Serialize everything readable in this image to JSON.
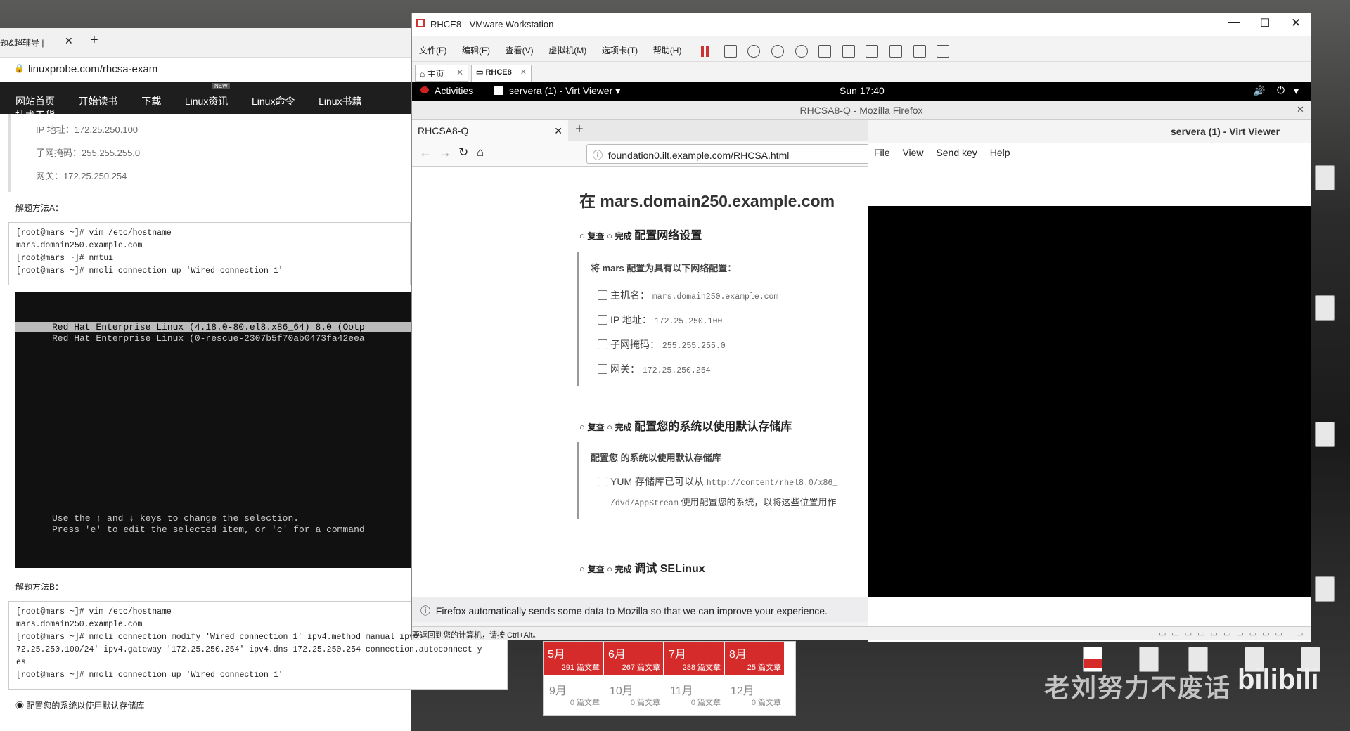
{
  "left_browser": {
    "tab_title": "题&超辅导 |",
    "url": "linuxprobe.com/rhcsa-exam",
    "nav": [
      "网站首页",
      "开始读书",
      "下载",
      "Linux资讯",
      "Linux命令",
      "Linux书籍",
      "技术干货"
    ],
    "nav_badge": "NEW",
    "net": [
      {
        "label": "IP 地址：",
        "value": "172.25.250.100"
      },
      {
        "label": "子网掩码：",
        "value": "255.255.255.0"
      },
      {
        "label": "网关：",
        "value": "172.25.250.254"
      }
    ],
    "method_a": "解题方法A：",
    "code_a": [
      "[root@mars ~]# vim /etc/hostname",
      "mars.domain250.example.com",
      "[root@mars ~]# nmtui",
      "[root@mars ~]# nmcli connection up 'Wired connection 1'"
    ],
    "grub": {
      "line1": "Red Hat Enterprise Linux (4.18.0-80.el8.x86_64) 8.0 (Ootp",
      "line2": "Red Hat Enterprise Linux (0-rescue-2307b5f70ab0473fa42eea",
      "help1": "Use the ↑ and ↓ keys to change the selection.",
      "help2": "Press 'e' to edit the selected item, or 'c' for a command"
    },
    "method_b": "解题方法B：",
    "code_b": [
      "[root@mars ~]# vim /etc/hostname",
      "mars.domain250.example.com",
      "[root@mars ~]# nmcli connection modify 'Wired connection 1' ipv4.method manual ipv4.addresses '1",
      "72.25.250.100/24' ipv4.gateway '172.25.250.254' ipv4.dns 172.25.250.254 connection.autoconnect y",
      "es",
      "[root@mars ~]# nmcli connection up 'Wired connection 1'"
    ],
    "footer_item": "配置您的系统以使用默认存储库"
  },
  "vmware": {
    "title": "RHCE8 - VMware Workstation",
    "menu": [
      "文件(F)",
      "编辑(E)",
      "查看(V)",
      "虚拟机(M)",
      "选项卡(T)",
      "帮助(H)"
    ],
    "tabs": [
      {
        "label": "主页"
      },
      {
        "label": "RHCE8"
      }
    ],
    "status": "要返回到您的计算机，请按 Ctrl+Alt。"
  },
  "gnome": {
    "activities": "Activities",
    "app": "servera (1) - Virt Viewer",
    "clock": "Sun 17:40"
  },
  "firefox": {
    "window_title": "RHCSA8-Q - Mozilla Firefox",
    "tab": "RHCSA8-Q",
    "url": "foundation0.ilt.example.com/RHCSA.html",
    "heading": "在 mars.domain250.example.com",
    "review": "复查",
    "done": "完成",
    "sections": [
      {
        "title": "配置网络设置",
        "intro": "将 mars 配置为具有以下网络配置：",
        "items": [
          {
            "label": "主机名：",
            "value": "mars.domain250.example.com"
          },
          {
            "label": "IP 地址：",
            "value": "172.25.250.100"
          },
          {
            "label": "子网掩码：",
            "value": "255.255.255.0"
          },
          {
            "label": "网关：",
            "value": "172.25.250.254"
          }
        ]
      },
      {
        "title": "配置您的系统以使用默认存储库",
        "intro": "配置您 的系统以使用默认存储库",
        "items": [
          {
            "label": "YUM 存储库已可以从",
            "value": "http://content/rhel8.0/x86_"
          },
          {
            "label": "",
            "value": "/dvd/AppStream",
            "suffix": "使用配置您的系统，以将这些位置用作"
          }
        ]
      },
      {
        "title": "调试 SELinux"
      }
    ],
    "notice": "Firefox automatically sends some data to Mozilla so that we can improve your experience."
  },
  "virt_viewer": {
    "title": "servera (1) - Virt Viewer",
    "menu": [
      "File",
      "View",
      "Send key",
      "Help"
    ]
  },
  "calendar": {
    "months_top": [
      {
        "name": "5月",
        "count": "291 篇文章"
      },
      {
        "name": "6月",
        "count": "267 篇文章"
      },
      {
        "name": "7月",
        "count": "288 篇文章"
      },
      {
        "name": "8月",
        "count": "25 篇文章"
      }
    ],
    "months_bottom": [
      {
        "name": "9月",
        "count": "0 篇文章"
      },
      {
        "name": "10月",
        "count": "0 篇文章"
      },
      {
        "name": "11月",
        "count": "0 篇文章"
      },
      {
        "name": "12月",
        "count": "0 篇文章"
      }
    ]
  },
  "watermark": "老刘努力不废话",
  "colors": {
    "accent_red": "#d62b2b",
    "nav_bg": "#1e1e1e",
    "vm_black": "#000000"
  }
}
